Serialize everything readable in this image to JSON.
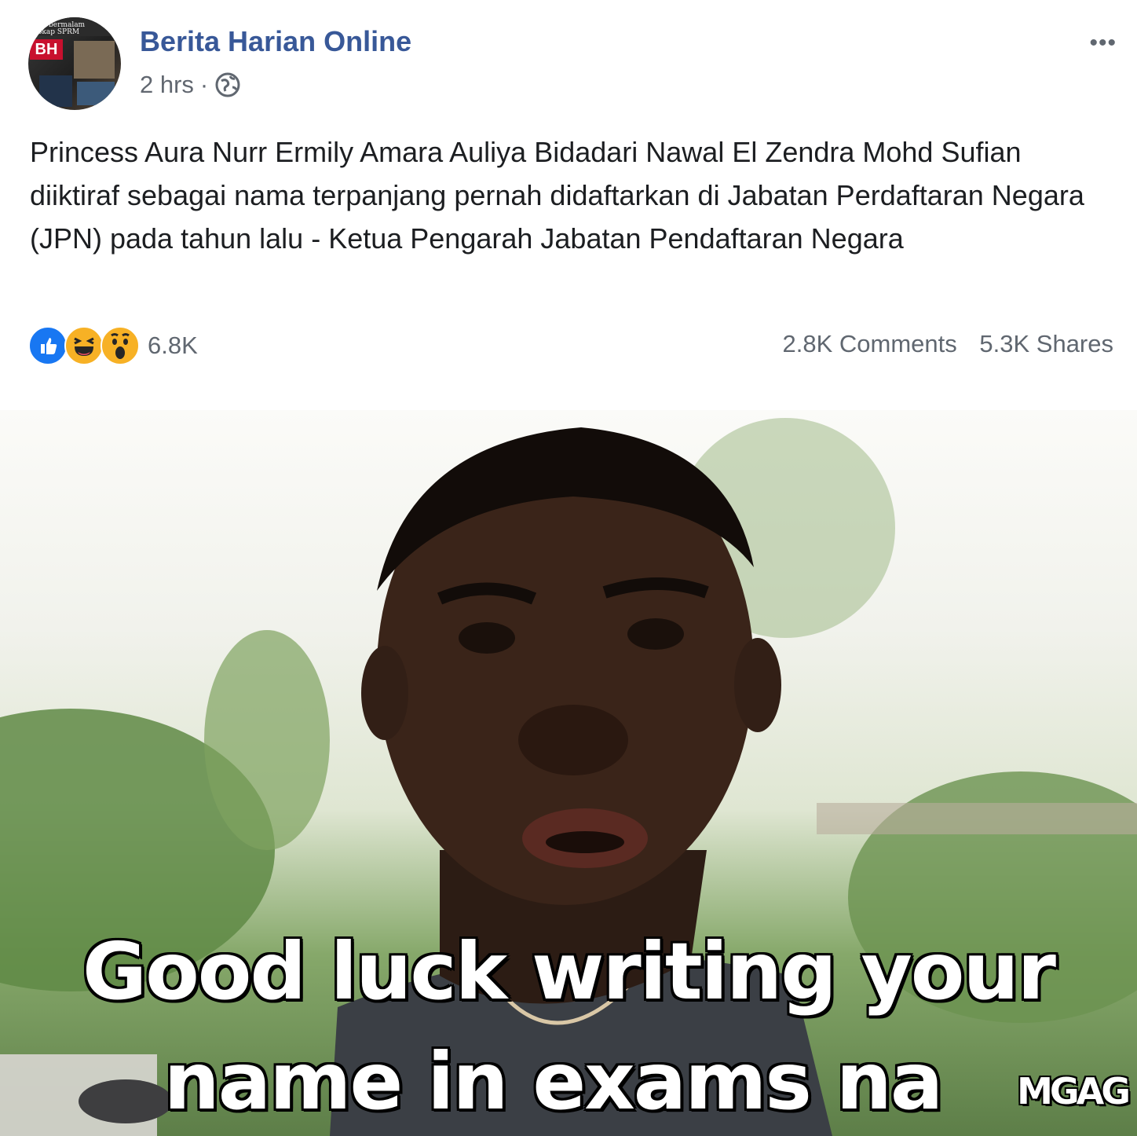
{
  "post": {
    "avatar": {
      "caption_line1": "an bermalam",
      "caption_line2": "okap SPRM",
      "logo": "BH"
    },
    "page_name": "Berita Harian Online",
    "time": "2 hrs",
    "separator": "·",
    "privacy_icon": "globe-icon",
    "more_icon": "more-options-icon",
    "more_label": "•••",
    "text": "Princess Aura Nurr Ermily Amara Auliya Bidadari Nawal El Zendra Mohd Sufian diiktiraf sebagai nama terpanjang pernah didaftarkan di Jabatan Perdaftaran Negara (JPN) pada tahun lalu - Ketua Pengarah Jabatan Pendaftaran Negara",
    "reactions": {
      "icons": [
        "like-icon",
        "haha-icon",
        "wow-icon"
      ],
      "count": "6.8K"
    },
    "comments": "2.8K Comments",
    "shares": "5.3K Shares"
  },
  "meme": {
    "caption_line1": "Good luck writing your",
    "caption_line2": "name in exams na",
    "watermark": "MGAG"
  },
  "colors": {
    "page_name": "#385898",
    "meta_text": "#616770",
    "body_text": "#1c1e21",
    "like_blue": "#1877f2",
    "emoji_yellow": "#f7b125"
  }
}
